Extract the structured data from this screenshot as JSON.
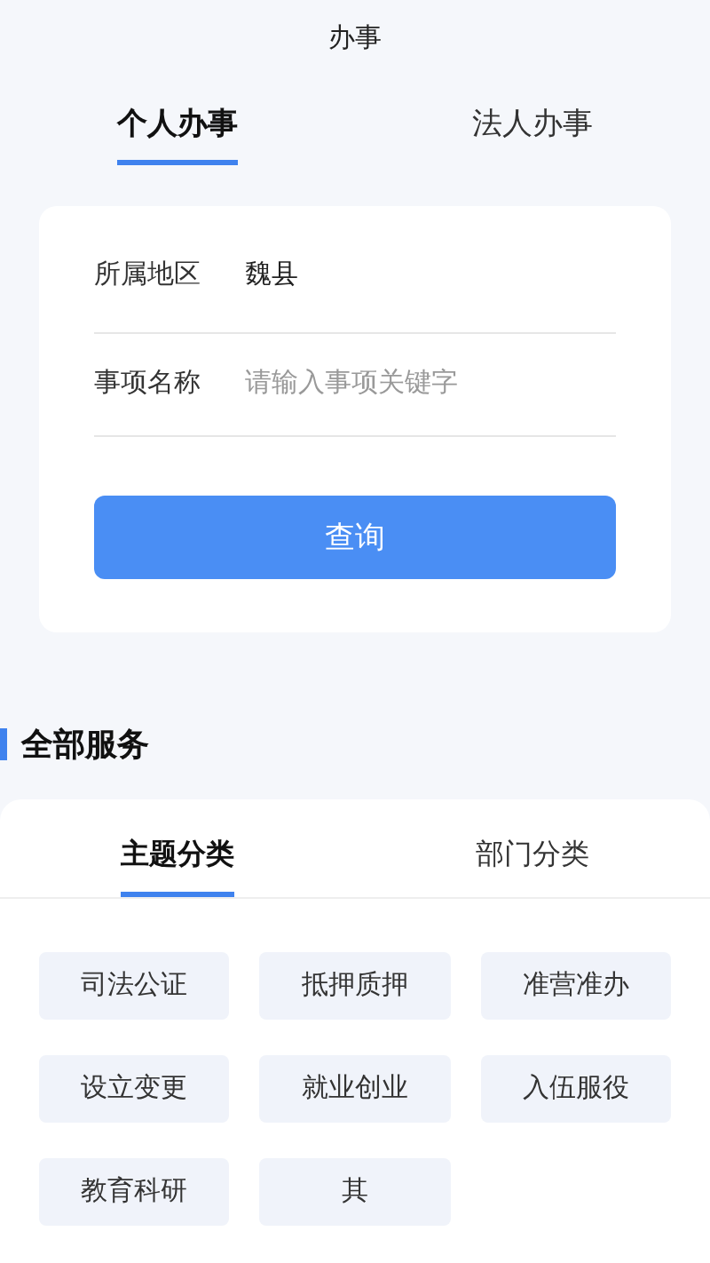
{
  "header": {
    "title": "办事"
  },
  "tabs": [
    {
      "label": "个人办事",
      "selected": true
    },
    {
      "label": "法人办事",
      "selected": false
    }
  ],
  "form": {
    "region": {
      "label": "所属地区",
      "value": "魏县"
    },
    "item": {
      "label": "事项名称",
      "placeholder": "请输入事项关键字"
    },
    "button": "查询"
  },
  "section": {
    "title": "全部服务"
  },
  "service_tabs": [
    {
      "label": "主题分类",
      "selected": true
    },
    {
      "label": "部门分类",
      "selected": false
    }
  ],
  "categories": [
    "司法公证",
    "抵押质押",
    "准营准办",
    "设立变更",
    "就业创业",
    "入伍服役",
    "教育科研",
    "其"
  ]
}
